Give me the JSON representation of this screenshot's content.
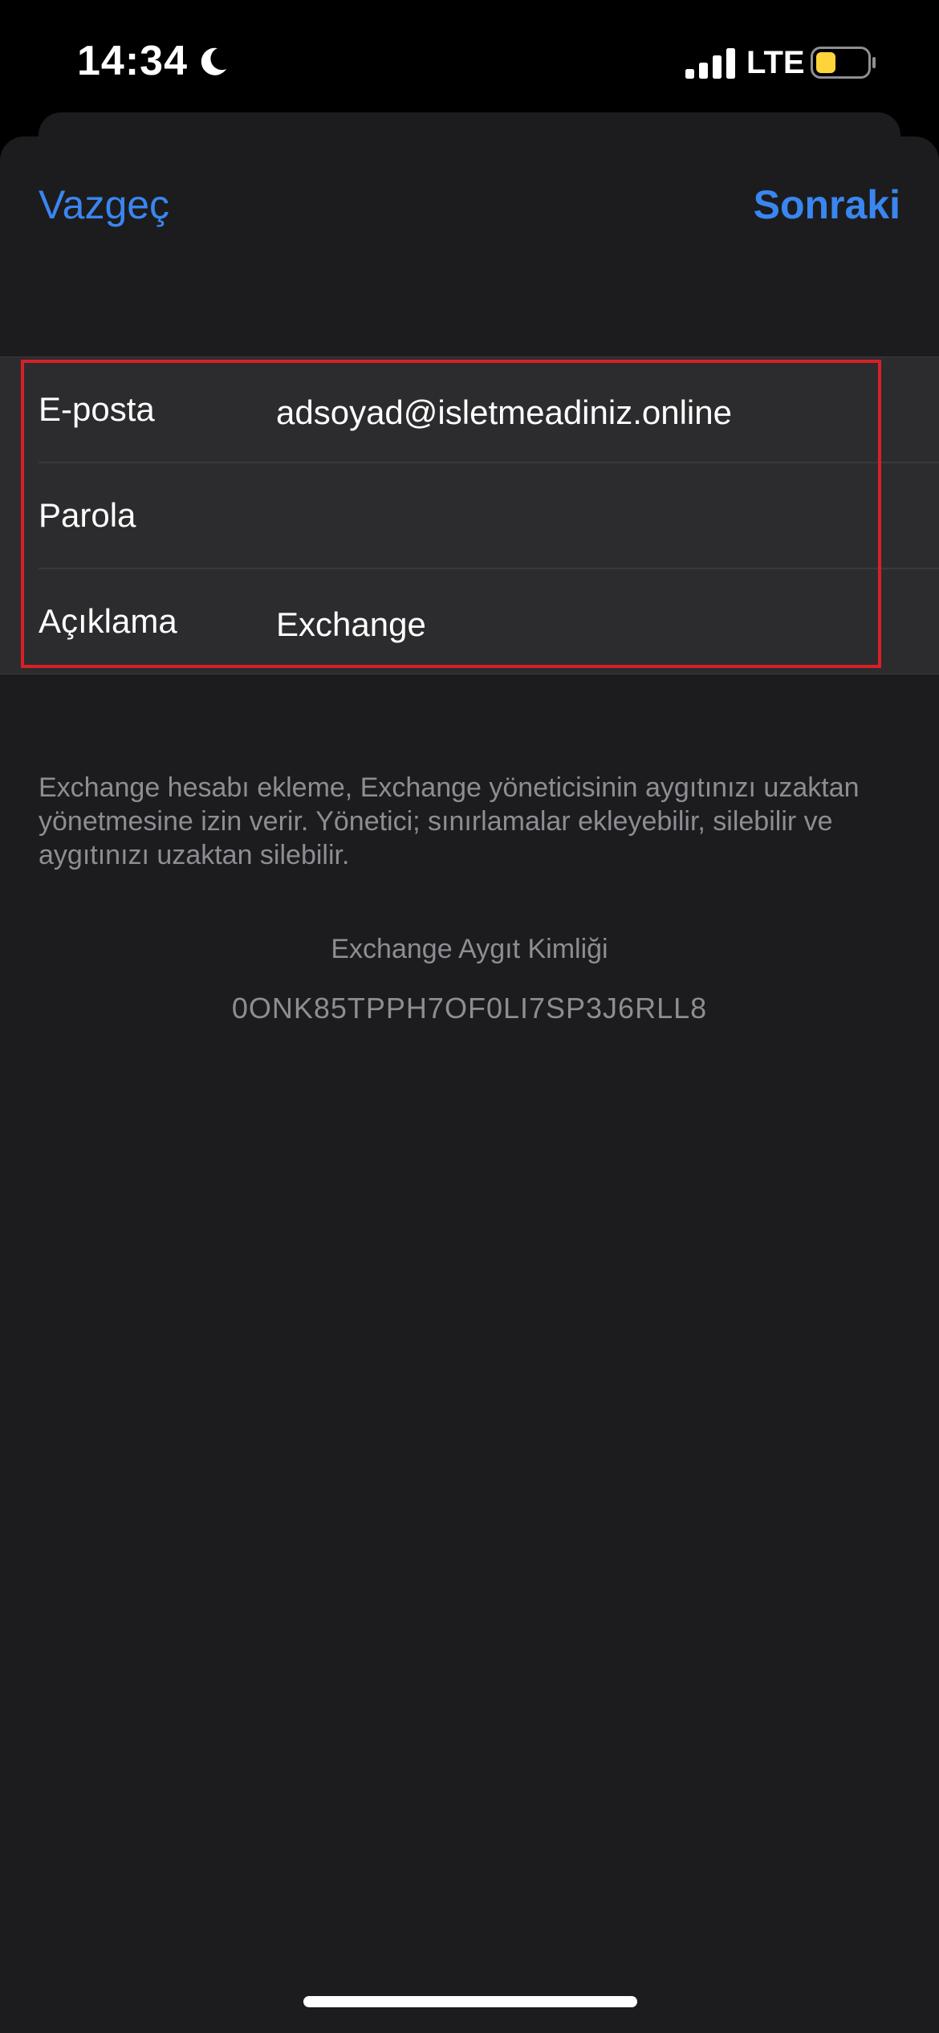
{
  "status_bar": {
    "time": "14:34",
    "network": "LTE",
    "moon_icon": "moon-icon",
    "signal_icon": "cellular-signal-icon",
    "battery_icon": "battery-icon",
    "battery_color": "#ffd43b"
  },
  "nav": {
    "cancel_label": "Vazgeç",
    "next_label": "Sonraki",
    "accent_color": "#3a86f0"
  },
  "form": {
    "rows": [
      {
        "label": "E-posta",
        "value": "adsoyad@isletmeadiniz.online",
        "placeholder": ""
      },
      {
        "label": "Parola",
        "value": "",
        "placeholder": ""
      },
      {
        "label": "Açıklama",
        "value": "Exchange",
        "placeholder": ""
      }
    ],
    "highlight_color": "#d91f26"
  },
  "footer": {
    "note": "Exchange hesabı ekleme, Exchange yöneticisinin aygıtınızı uzaktan yönetmesine izin verir. Yönetici; sınırlamalar ekleyebilir, silebilir ve aygıtınızı uzaktan silebilir.",
    "device_id_title": "Exchange Aygıt Kimliği",
    "device_id_value": "0ONK85TPPH7OF0LI7SP3J6RLL8"
  }
}
